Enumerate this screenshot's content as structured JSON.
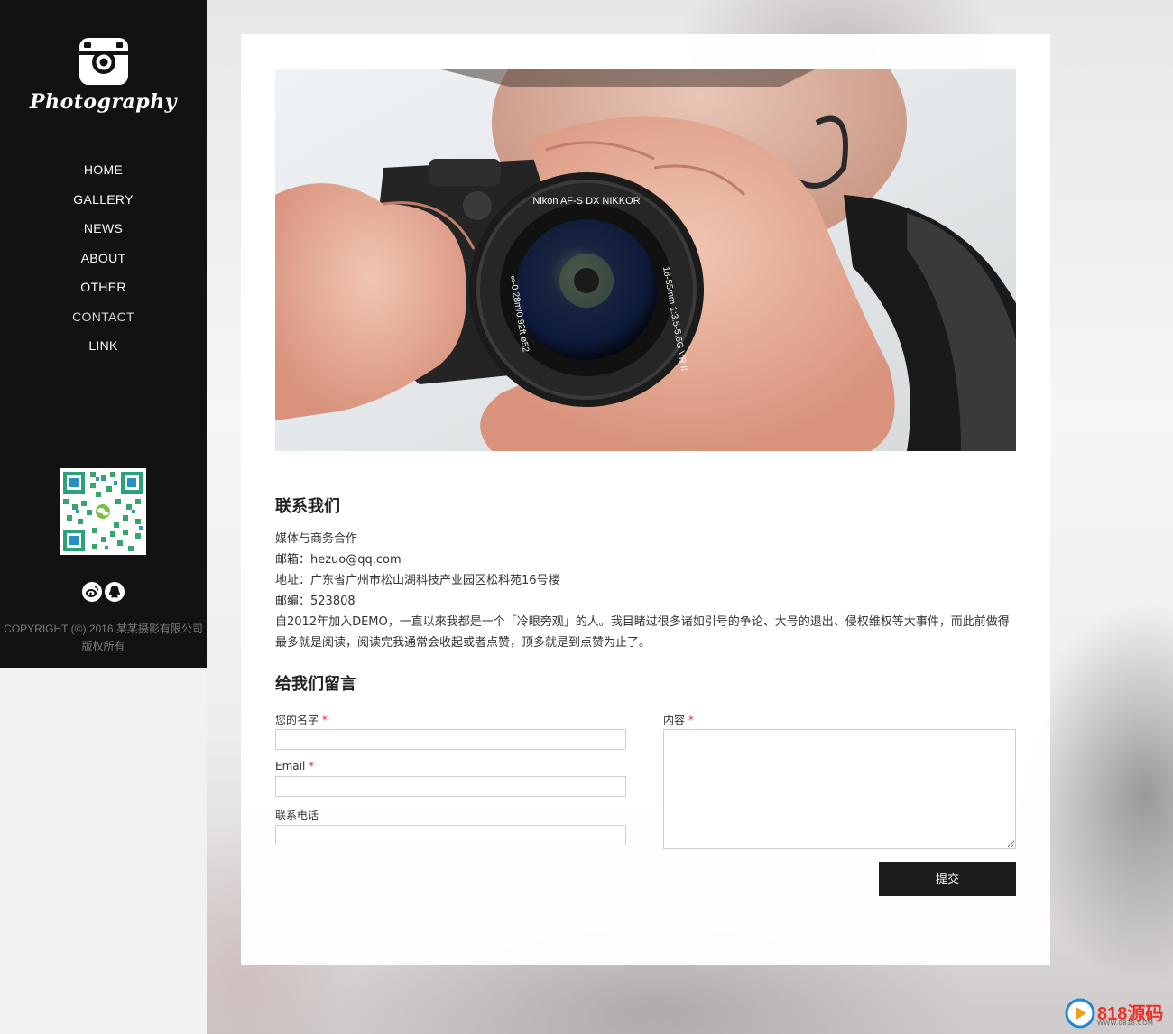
{
  "sidebar": {
    "logo_text": "Photography",
    "nav": [
      {
        "label": "HOME"
      },
      {
        "label": "GALLERY"
      },
      {
        "label": "NEWS"
      },
      {
        "label": "ABOUT"
      },
      {
        "label": "OTHER"
      },
      {
        "label": "CONTACT"
      },
      {
        "label": "LINK"
      }
    ],
    "copyright_line1": "COPYRIGHT (©) 2016 某某摄影有限公司",
    "copyright_line2": "版权所有"
  },
  "hero": {
    "lens_text_top": "Nikon AF-S DX NIKKOR",
    "lens_text_right": "18-55mm 1:3.5-5.6G VR II",
    "lens_text_left": "∞-0.28m/0.92ft ø52"
  },
  "contact": {
    "title": "联系我们",
    "line1": "媒体与商务合作",
    "email": "邮箱：hezuo@qq.com",
    "address": "地址：广东省广州市松山湖科技产业园区松科苑16号楼",
    "postcode": "邮编：523808",
    "para": "自2012年加入DEMO，一直以來我都是一个「冷眼旁观」的人。我目睹过很多诸如引号的争论、大号的退出、侵权维权等大事件，而此前做得最多就是阅读，阅读完我通常会收起或者点赞，顶多就是到点赞为止了。"
  },
  "form": {
    "title": "给我们留言",
    "name_label": "您的名字",
    "email_label": "Email",
    "phone_label": "联系电话",
    "content_label": "内容",
    "required_mark": "*",
    "name_value": "",
    "email_value": "",
    "phone_value": "",
    "content_value": "",
    "submit_label": "提交"
  },
  "watermark": {
    "text": "818源码",
    "sub": "WWW.0818.COM"
  }
}
